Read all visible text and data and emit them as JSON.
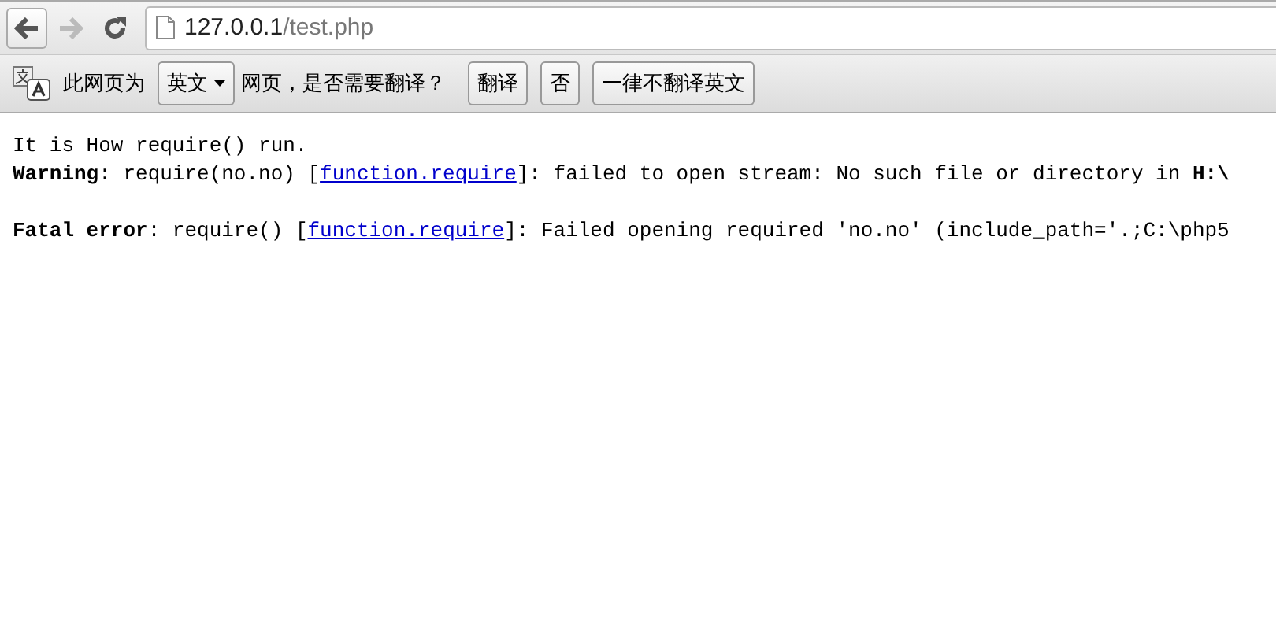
{
  "toolbar": {
    "nav_buttons": [
      {
        "kind": "back",
        "disabled": false
      },
      {
        "kind": "forward",
        "disabled": true
      },
      {
        "kind": "reload",
        "disabled": false
      }
    ],
    "address": {
      "host": "127.0.0.1",
      "path": "/test.php"
    }
  },
  "translate_bar": {
    "prefix": "此网页为",
    "language": "英文",
    "suffix": "网页，是否需要翻译？",
    "buttons": [
      "翻译",
      "否",
      "一律不翻译英文"
    ]
  },
  "page": {
    "blocks": [
      {
        "lines": [
          {
            "before": "It is How require() run."
          },
          {
            "before": "**Warning**: require(no.no) [",
            "link": "function.require",
            "after": "]: failed to open stream: No such file or directory in **H:\\**"
          }
        ]
      },
      {
        "lines": [
          {
            "before": "**Fatal error**: require() [",
            "link": "function.require",
            "after": "]: Failed opening required 'no.no' (include_path='.;C:\\php5"
          }
        ]
      }
    ]
  }
}
